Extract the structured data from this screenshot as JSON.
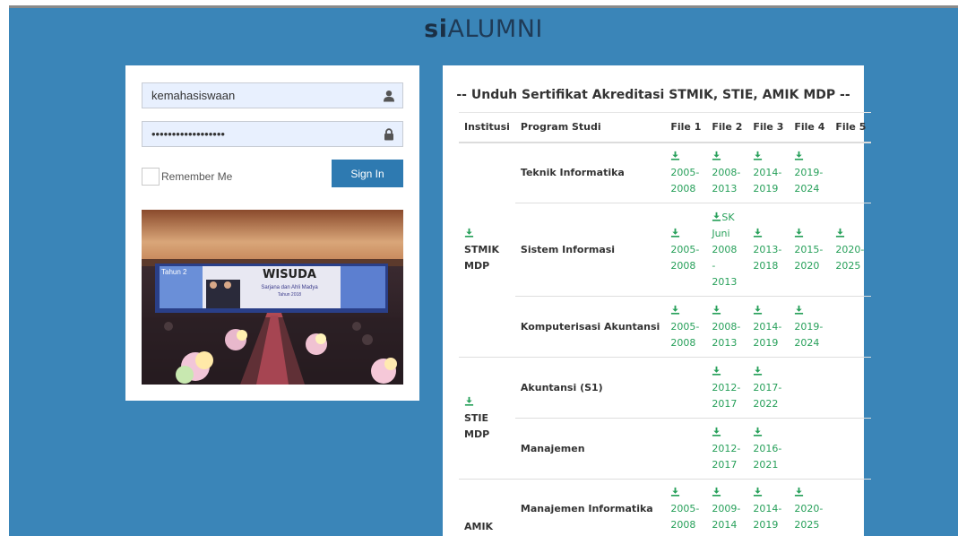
{
  "brand": {
    "bold": "si",
    "rest": "ALUMNI"
  },
  "login": {
    "username_value": "kemahasiswaan",
    "password_value": "••••••••••••••••••",
    "remember_label": "Remember Me",
    "signin_label": "Sign In",
    "photo": {
      "banner_title": "WISUDA",
      "banner_sub": "Sarjana dan Ahli Madya",
      "banner_year": "Tahun 2018",
      "corner_text": "Tahun 2"
    }
  },
  "downloads": {
    "title": "-- Unduh Sertifikat Akreditasi STMIK, STIE, AMIK MDP --",
    "headers": [
      "Institusi",
      "Program Studi",
      "File 1",
      "File 2",
      "File 3",
      "File 4",
      "File 5"
    ],
    "groups": [
      {
        "institution": "STMIK MDP",
        "rows": [
          {
            "program": "Teknik Informatika",
            "files": [
              "2005-2008",
              "2008-2013",
              "2014-2019",
              "2019-2024",
              ""
            ]
          },
          {
            "program": "Sistem Informasi",
            "files": [
              "2005-2008",
              "SK Juni 2008 - 2013",
              "2013-2018",
              "2015-2020",
              "2020-2025"
            ]
          },
          {
            "program": "Komputerisasi Akuntansi",
            "files": [
              "2005-2008",
              "2008-2013",
              "2014-2019",
              "2019-2024",
              ""
            ]
          }
        ]
      },
      {
        "institution": "STIE MDP",
        "rows": [
          {
            "program": "Akuntansi (S1)",
            "files": [
              "",
              "2012-2017",
              "2017-2022",
              "",
              ""
            ]
          },
          {
            "program": "Manajemen",
            "files": [
              "",
              "2012-2017",
              "2016-2021",
              "",
              ""
            ]
          }
        ]
      },
      {
        "institution": "AMIK",
        "rows": [
          {
            "program": "Manajemen Informatika",
            "files": [
              "2005-2008",
              "2009-2014",
              "2014-2019",
              "2020-2025",
              ""
            ]
          }
        ]
      }
    ]
  },
  "colors": {
    "background": "#3a85b8",
    "button": "#2e7ab1",
    "link": "#27a05a"
  }
}
